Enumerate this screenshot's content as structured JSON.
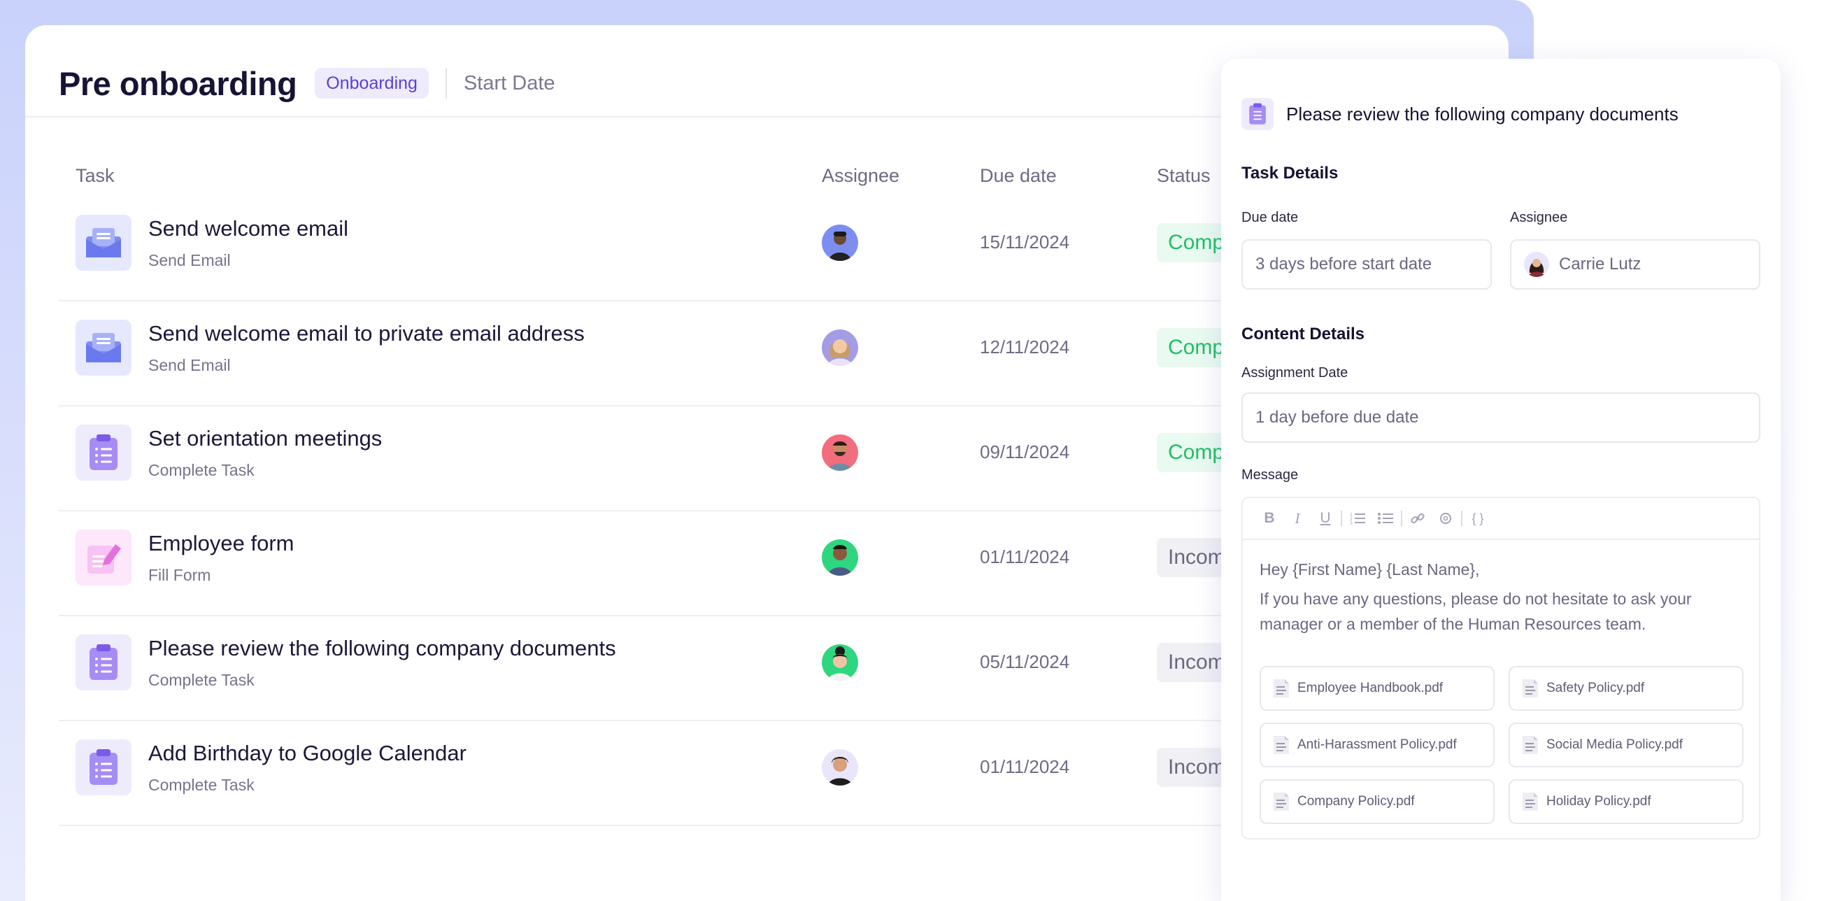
{
  "header": {
    "title": "Pre onboarding",
    "tag": "Onboarding",
    "start_date_label": "Start Date"
  },
  "table": {
    "columns": [
      "Task",
      "Assignee",
      "Due date",
      "Status"
    ],
    "rows": [
      {
        "title": "Send welcome email",
        "type": "Send Email",
        "icon": "envelope-icon",
        "due": "15/11/2024",
        "status": "Complete"
      },
      {
        "title": "Send welcome email to private email address",
        "type": "Send Email",
        "icon": "envelope-icon",
        "due": "12/11/2024",
        "status": "Complete"
      },
      {
        "title": "Set orientation meetings",
        "type": "Complete Task",
        "icon": "clipboard-icon",
        "due": "09/11/2024",
        "status": "Complete"
      },
      {
        "title": "Employee form",
        "type": "Fill Form",
        "icon": "form-edit-icon",
        "due": "01/11/2024",
        "status": "Incomplete"
      },
      {
        "title": "Please review the following company documents",
        "type": "Complete Task",
        "icon": "clipboard-icon",
        "due": "05/11/2024",
        "status": "Incomplete"
      },
      {
        "title": "Add Birthday to Google Calendar",
        "type": "Complete Task",
        "icon": "clipboard-icon",
        "due": "01/11/2024",
        "status": "Incomplete"
      }
    ]
  },
  "panel": {
    "title": "Please review the following company documents",
    "task_details_title": "Task Details",
    "due_date_label": "Due date",
    "due_date_value": "3 days before start date",
    "assignee_label": "Assignee",
    "assignee_value": "Carrie Lutz",
    "content_details_title": "Content Details",
    "assignment_date_label": "Assignment Date",
    "assignment_date_value": "1 day before due date",
    "message_label": "Message",
    "toolbar": [
      "bold-icon",
      "italic-icon",
      "underline-icon",
      "ordered-list-icon",
      "bullet-list-icon",
      "link-icon",
      "mention-icon",
      "code-braces-icon"
    ],
    "message_line1": "Hey {First Name} {Last Name},",
    "message_line2": "If you have any questions, please do not hesitate to ask your manager or a member of the Human Resources team.",
    "attachments": [
      "Employee Handbook.pdf",
      "Safety Policy.pdf",
      "Anti-Harassment Policy.pdf",
      "Social Media Policy.pdf",
      "Company Policy.pdf",
      "Holiday Policy.pdf"
    ]
  },
  "colors": {
    "accent": "#5b3fd6",
    "complete": "#1fbf63",
    "complete_bg": "#e9fbf0",
    "incomplete_bg": "#f0f0f5",
    "frame": "#c9d2fb"
  }
}
